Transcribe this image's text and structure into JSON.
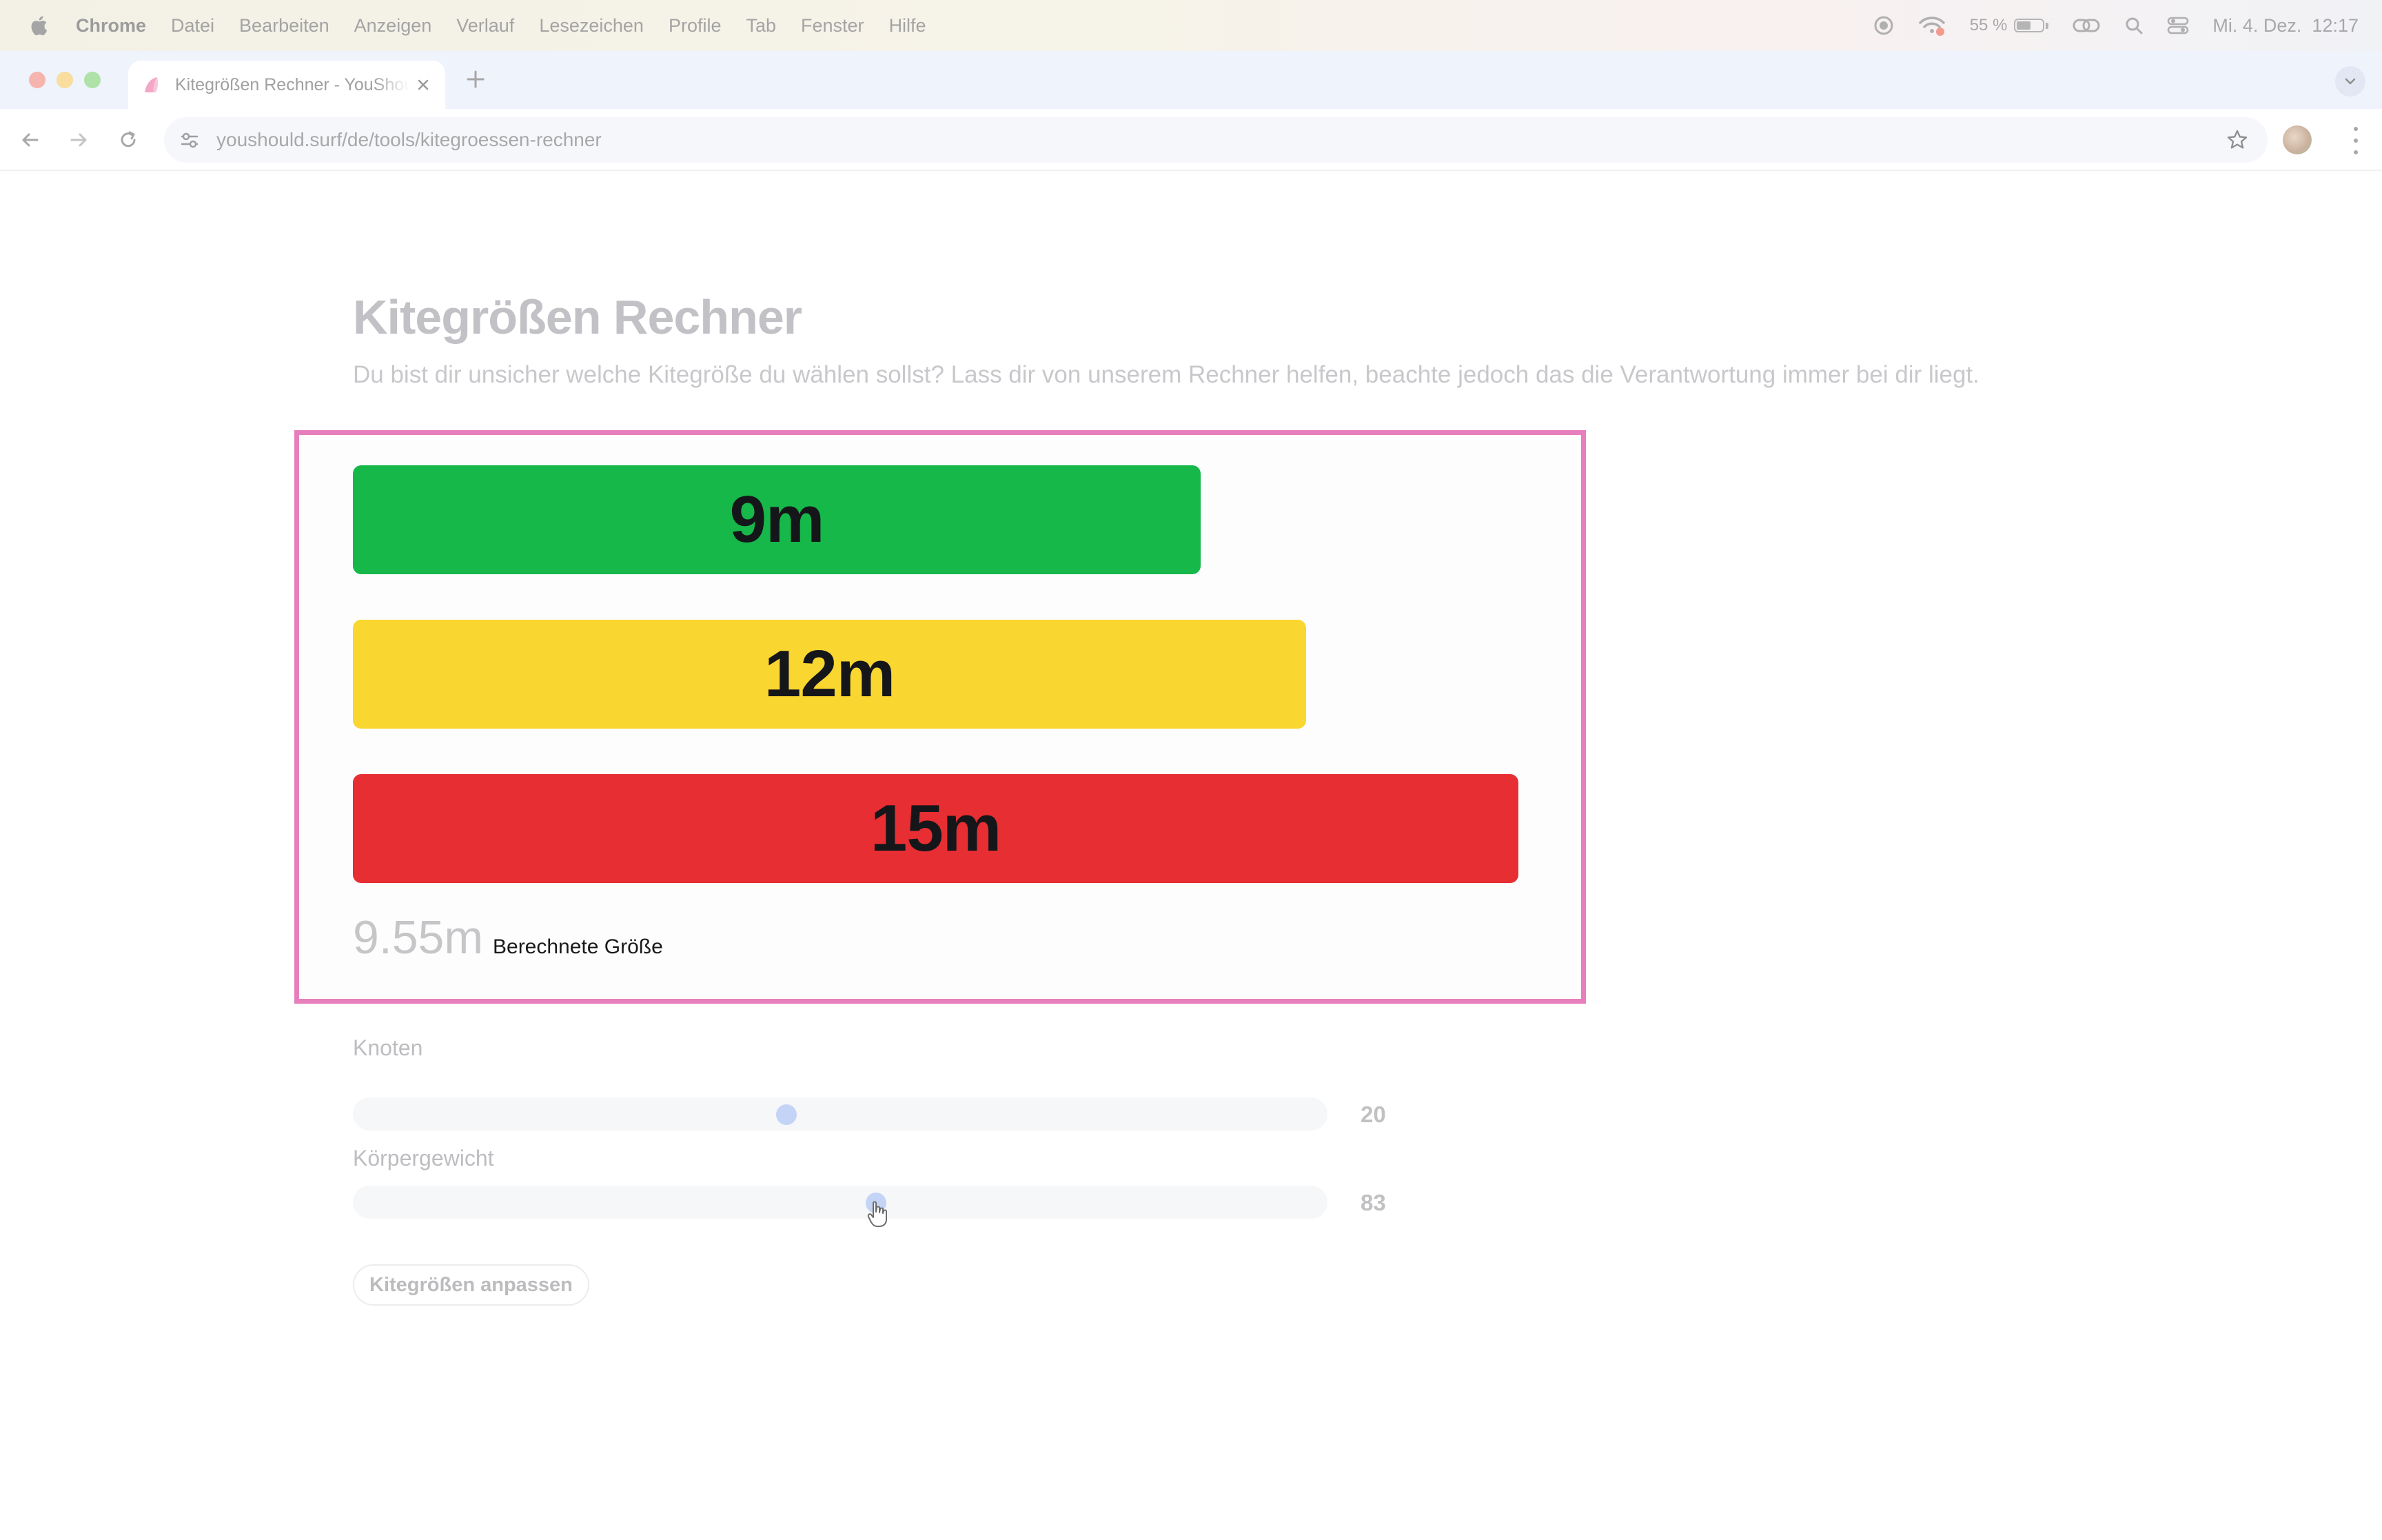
{
  "menubar": {
    "app": "Chrome",
    "items": [
      "Datei",
      "Bearbeiten",
      "Anzeigen",
      "Verlauf",
      "Lesezeichen",
      "Profile",
      "Tab",
      "Fenster",
      "Hilfe"
    ],
    "battery_percent": "55 %",
    "battery_level": 0.55,
    "datetime": "Mi. 4. Dez.  12:17"
  },
  "browser": {
    "tab_title": "Kitegrößen Rechner - YouShould.surf",
    "url": "youshould.surf/de/tools/kitegroessen-rechner"
  },
  "page": {
    "title": "Kitegrößen Rechner",
    "subtitle": "Du bist dir unsicher welche Kitegröße du wählen sollst? Lass dir von unserem Rechner helfen, beachte jedoch das die Verantwortung immer bei dir liegt."
  },
  "calculator": {
    "bars": [
      {
        "label": "9m",
        "color": "#16b84a"
      },
      {
        "label": "12m",
        "color": "#fad630"
      },
      {
        "label": "15m",
        "color": "#e62e33"
      }
    ],
    "result_value": "9.55m",
    "result_label": "Berechnete Größe"
  },
  "sliders": {
    "knots": {
      "label": "Knoten",
      "value": "20",
      "fraction": 0.445
    },
    "weight": {
      "label": "Körpergewicht",
      "value": "83",
      "fraction": 0.537
    }
  },
  "adjust_button": "Kitegrößen anpassen",
  "colors": {
    "highlight_border": "#e77fbc",
    "slider_thumb": "#c3d4f6"
  },
  "icons": [
    "apple-icon",
    "screen-record-icon",
    "wifi-icon",
    "battery-icon",
    "link-icon",
    "search-icon",
    "control-center-icon",
    "back-icon",
    "forward-icon",
    "reload-icon",
    "site-settings-icon",
    "bookmark-star-icon",
    "menu-kebab-icon",
    "tab-close-icon",
    "new-tab-icon",
    "cursor-hand-icon"
  ]
}
